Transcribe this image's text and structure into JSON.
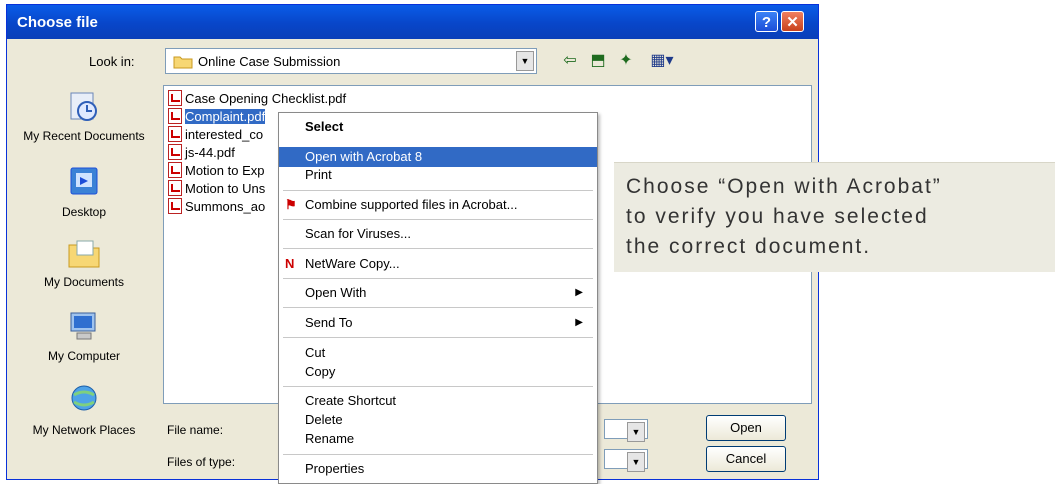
{
  "dialog": {
    "title": "Choose file",
    "help_glyph": "?",
    "close_glyph": "✕"
  },
  "lookin": {
    "label": "Look in:",
    "value": "Online Case Submission"
  },
  "places": [
    {
      "label": "My Recent Documents",
      "icon": "recent-documents-icon"
    },
    {
      "label": "Desktop",
      "icon": "desktop-icon"
    },
    {
      "label": "My Documents",
      "icon": "my-documents-icon"
    },
    {
      "label": "My Computer",
      "icon": "my-computer-icon"
    },
    {
      "label": "My Network Places",
      "icon": "network-places-icon"
    }
  ],
  "files": [
    "Case Opening Checklist.pdf",
    "Complaint.pdf",
    "interested_co",
    "js-44.pdf",
    "Motion to Exp",
    "Motion to Uns",
    "Summons_ao"
  ],
  "context_menu": {
    "items": [
      "Select",
      "Open with Acrobat 8",
      "Print",
      "Combine supported files in Acrobat...",
      "Scan for Viruses...",
      "NetWare Copy...",
      "Open With",
      "Send To",
      "Cut",
      "Copy",
      "Create Shortcut",
      "Delete",
      "Rename",
      "Properties"
    ]
  },
  "bottom": {
    "file_name_label": "File name:",
    "files_of_type_label": "Files of type:",
    "open_button": "Open",
    "cancel_button": "Cancel"
  },
  "callout": {
    "line1": "Choose “Open with Acrobat”",
    "line2": "to verify you have selected",
    "line3": "the correct document."
  },
  "colors": {
    "title_bar": "#0a5ce8",
    "selection": "#316ac5",
    "dialog_bg": "#ece9d8"
  }
}
